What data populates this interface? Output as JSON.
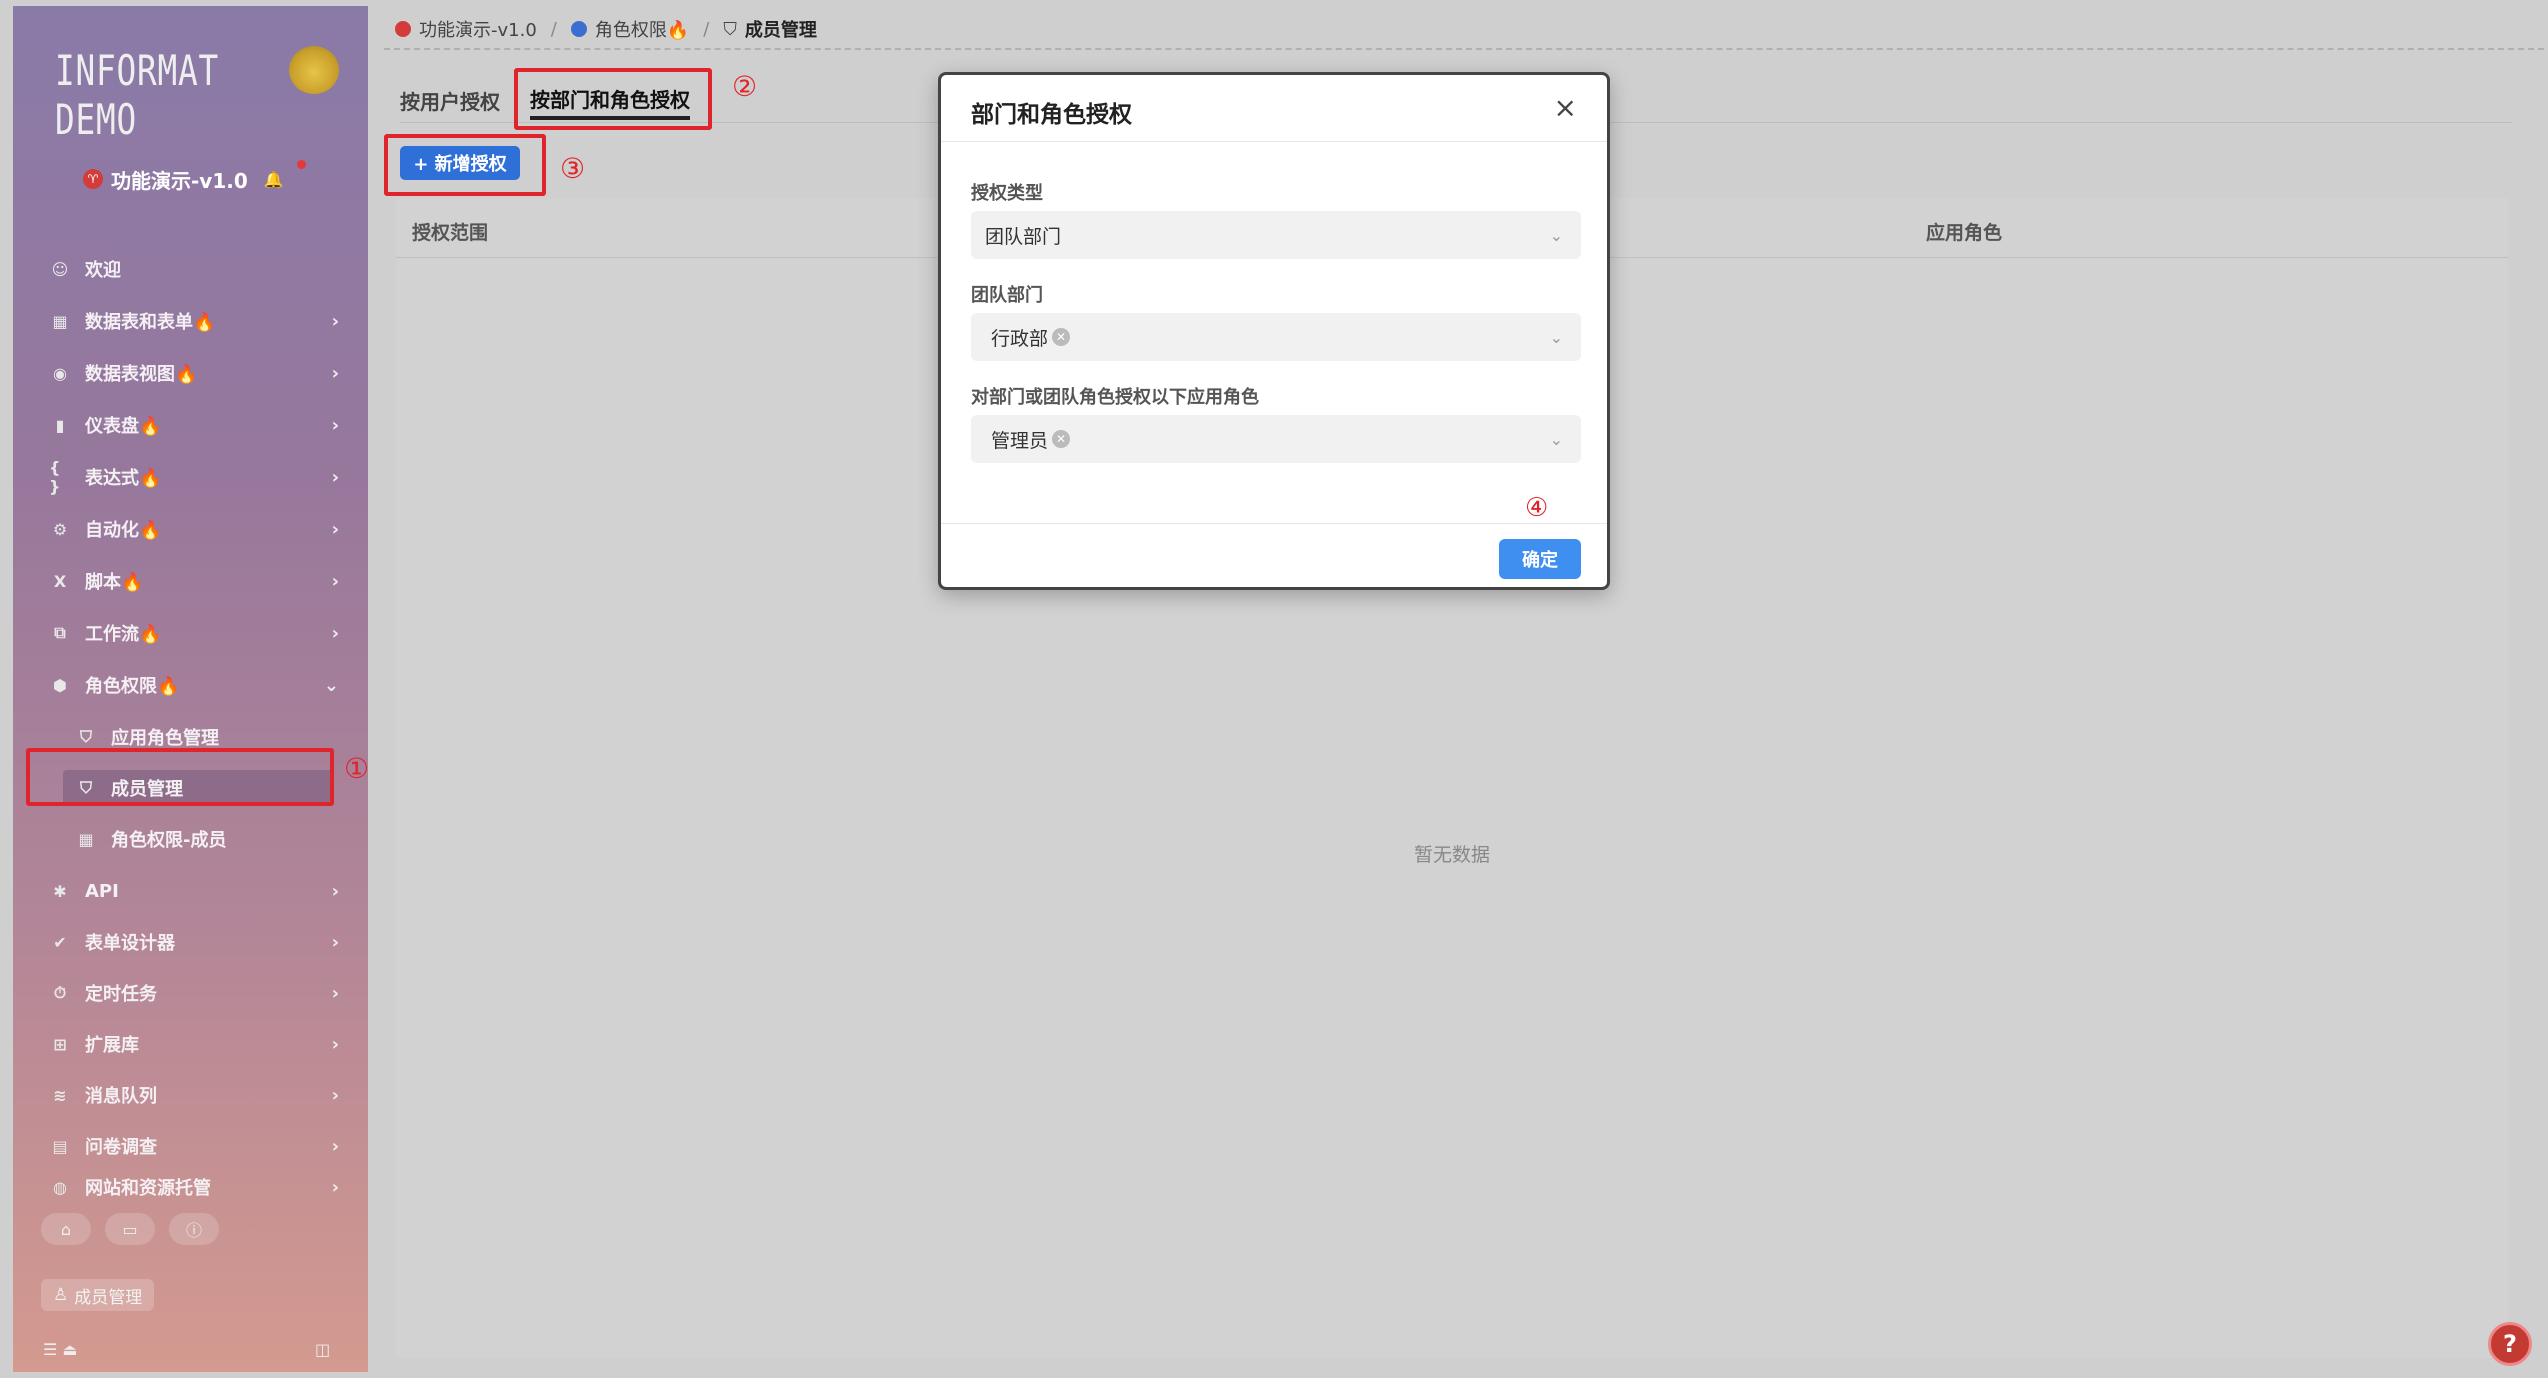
{
  "sidebar": {
    "logo_text": "INFORMAT DEMO",
    "app_name": "功能演示-v1.0",
    "items": [
      {
        "label": "欢迎",
        "icon": "smile-icon",
        "glyph": "☺"
      },
      {
        "label": "数据表和表单🔥",
        "icon": "table-icon",
        "glyph": "▦"
      },
      {
        "label": "数据表视图🔥",
        "icon": "view-icon",
        "glyph": "◉"
      },
      {
        "label": "仪表盘🔥",
        "icon": "dashboard-icon",
        "glyph": "▮"
      },
      {
        "label": "表达式🔥",
        "icon": "braces-icon",
        "glyph": "{ }"
      },
      {
        "label": "自动化🔥",
        "icon": "robot-icon",
        "glyph": "⚙"
      },
      {
        "label": "脚本🔥",
        "icon": "script-icon",
        "glyph": "X"
      },
      {
        "label": "工作流🔥",
        "icon": "workflow-icon",
        "glyph": "⧉"
      },
      {
        "label": "角色权限🔥",
        "icon": "shield-icon",
        "glyph": "⬢"
      }
    ],
    "sub_items": [
      {
        "label": "应用角色管理"
      },
      {
        "label": "成员管理"
      },
      {
        "label": "角色权限-成员"
      }
    ],
    "items_after": [
      {
        "label": "API",
        "icon": "api-icon",
        "glyph": "✱"
      },
      {
        "label": "表单设计器",
        "icon": "check-icon",
        "glyph": "✔"
      },
      {
        "label": "定时任务",
        "icon": "timer-icon",
        "glyph": "⏱"
      },
      {
        "label": "扩展库",
        "icon": "library-icon",
        "glyph": "⊞"
      },
      {
        "label": "消息队列",
        "icon": "queue-icon",
        "glyph": "≋"
      },
      {
        "label": "问卷调查",
        "icon": "clipboard-icon",
        "glyph": "▤"
      },
      {
        "label": "网站和资源托管",
        "icon": "globe-icon",
        "glyph": "◍"
      }
    ],
    "current_tag": "成员管理"
  },
  "annotations": {
    "one": "①",
    "two": "②",
    "three": "③",
    "four": "④"
  },
  "breadcrumb": {
    "items": [
      "功能演示-v1.0",
      "角色权限🔥"
    ],
    "current": "成员管理",
    "separator": "/"
  },
  "tabs": [
    "按用户授权",
    "按部门和角色授权"
  ],
  "toolbar": {
    "add_label": "+ 新增授权"
  },
  "table": {
    "columns": [
      "授权范围",
      "应用角色"
    ],
    "empty_text": "暂无数据"
  },
  "modal": {
    "title": "部门和角色授权",
    "close": "×",
    "fields": [
      {
        "label": "授权类型",
        "value": "团队部门"
      },
      {
        "label": "团队部门",
        "value": "行政部"
      },
      {
        "label": "对部门或团队角色授权以下应用角色",
        "value": "管理员"
      }
    ],
    "confirm_label": "确定"
  },
  "help": "?"
}
